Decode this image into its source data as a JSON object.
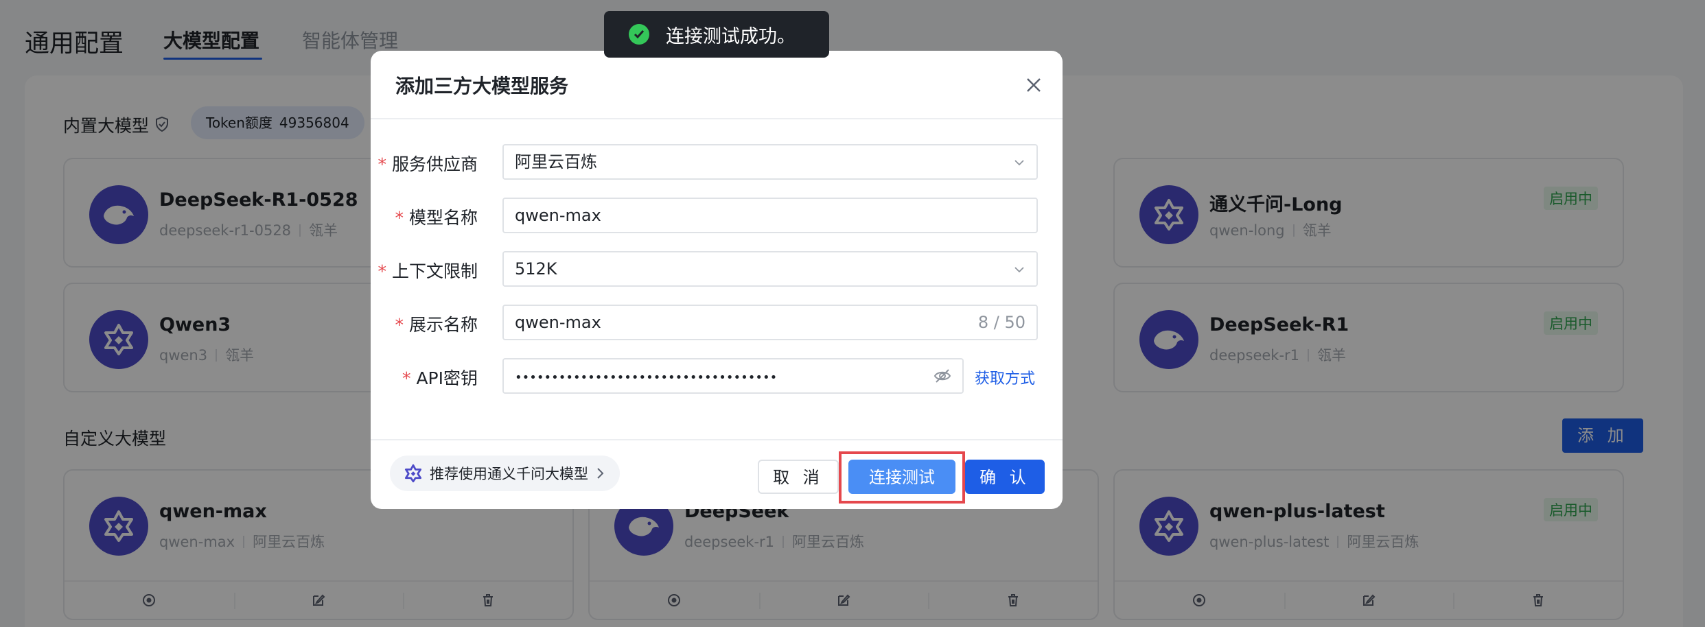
{
  "header": {
    "title": "通用配置",
    "tabs": [
      {
        "label": "大模型配置",
        "active": true
      },
      {
        "label": "智能体管理",
        "active": false
      }
    ]
  },
  "builtin": {
    "title": "内置大模型",
    "token_label": "Token额度",
    "token_value": "49356804",
    "cards": [
      {
        "name": "DeepSeek-R1-0528",
        "id": "deepseek-r1-0528",
        "provider": "瓴羊",
        "icon": "deepseek-whale-icon"
      },
      {
        "name": "通义千问-Long",
        "id": "qwen-long",
        "provider": "瓴羊",
        "status": "启用中",
        "icon": "qwen-star-icon"
      },
      {
        "name": "Qwen3",
        "id": "qwen3",
        "provider": "瓴羊",
        "icon": "qwen-star-icon"
      },
      {
        "name": "DeepSeek-R1",
        "id": "deepseek-r1",
        "provider": "瓴羊",
        "status": "启用中",
        "icon": "deepseek-whale-icon"
      }
    ]
  },
  "custom": {
    "title": "自定义大模型",
    "add_label": "添 加",
    "cards": [
      {
        "name": "qwen-max",
        "id": "qwen-max",
        "provider": "阿里云百炼",
        "icon": "qwen-star-icon"
      },
      {
        "name": "DeepSeek",
        "id": "deepseek-r1",
        "provider": "阿里云百炼",
        "icon": "deepseek-whale-icon"
      },
      {
        "name": "qwen-plus-latest",
        "id": "qwen-plus-latest",
        "provider": "阿里云百炼",
        "status": "启用中",
        "icon": "qwen-star-icon"
      }
    ]
  },
  "modal": {
    "title": "添加三方大模型服务",
    "fields": {
      "provider": {
        "label": "服务供应商",
        "value": "阿里云百炼"
      },
      "model_name": {
        "label": "模型名称",
        "value": "qwen-max"
      },
      "context_limit": {
        "label": "上下文限制",
        "value": "512K"
      },
      "display_name": {
        "label": "展示名称",
        "value": "qwen-max",
        "counter": "8 / 50"
      },
      "api_key": {
        "label": "API密钥",
        "value": "••••••••••••••••••••••••••••••••••••",
        "link": "获取方式"
      }
    },
    "recommend": "推荐使用通义千问大模型",
    "buttons": {
      "cancel": "取 消",
      "test": "连接测试",
      "confirm": "确 认"
    }
  },
  "toast": {
    "message": "连接测试成功。"
  },
  "colors": {
    "primary": "#1e5ee6",
    "test_button": "#4a8ef5",
    "success": "#34c759",
    "highlight": "#e5484d",
    "avatar": "#4d4bc8"
  }
}
